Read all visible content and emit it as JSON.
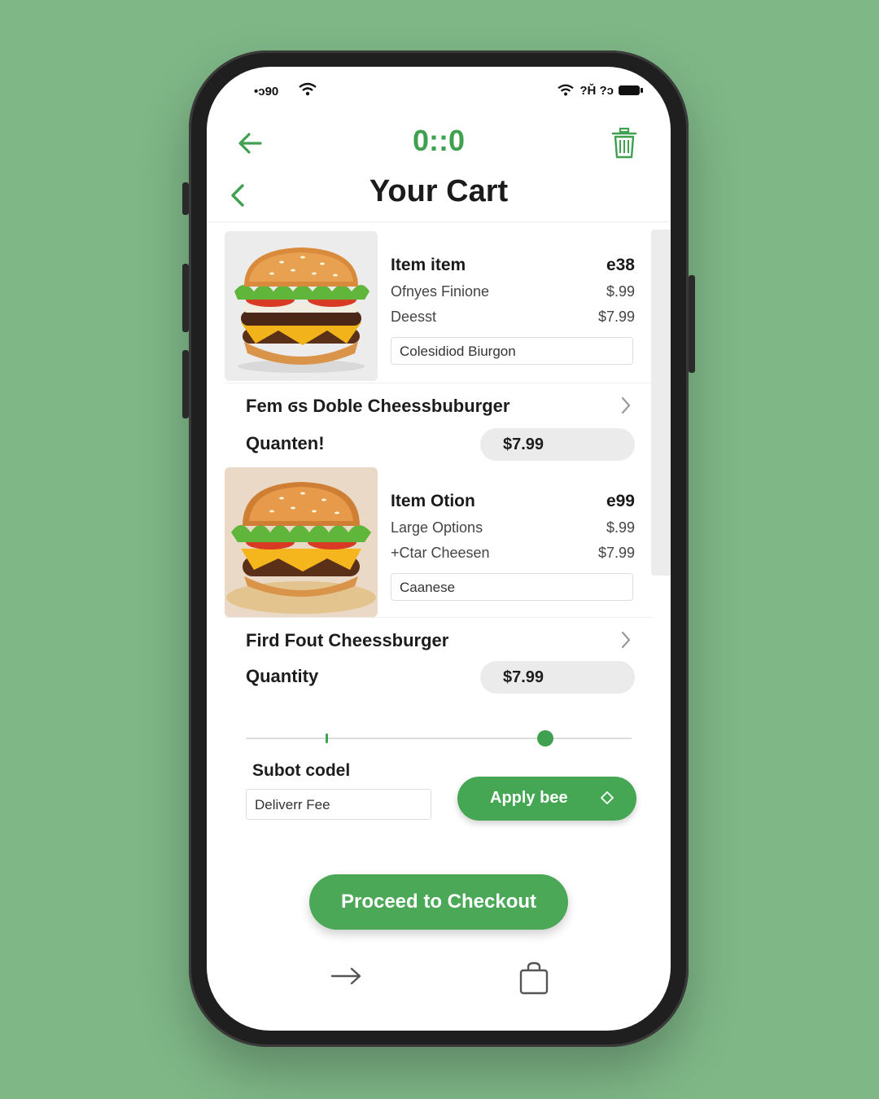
{
  "status_bar": {
    "carrier": "•ᴐ90",
    "right": "?Ȟ ?ᴐ"
  },
  "topbar": {
    "timer": "0::0"
  },
  "header": {
    "title": "Your Cart"
  },
  "items": [
    {
      "head_name": "Item item",
      "head_price": "e38",
      "opt1_name": "Ofnyes Finione",
      "opt1_price": "$.99",
      "opt2_name": "Deesst",
      "opt2_price": "$7.99",
      "note": "Colesidiod Biurgon",
      "title": "Fem ϭs Doble Cheessbuburger",
      "qty_label": "Quanten!",
      "price": "$7.99"
    },
    {
      "head_name": "Item Otion",
      "head_price": "e99",
      "opt1_name": "Large Options",
      "opt1_price": "$.99",
      "opt2_name": "+Ctar Cheesen",
      "opt2_price": "$7.99",
      "note": "Caanese",
      "title": "Fird Fout Cheessburger",
      "qty_label": "Quantity",
      "price": "$7.99"
    }
  ],
  "promo": {
    "label": "Subot codel",
    "input_value": "Deliverr Fee",
    "apply_label": "Apply bee"
  },
  "checkout": {
    "label": "Proceed to Checkout"
  },
  "icons": {
    "back": "arrow-left-icon",
    "trash": "trash-icon",
    "chevron": "chevron-left-icon",
    "nav_forward": "arrow-right-icon",
    "nav_cart": "shopping-bag-icon",
    "apply": "diamond-icon"
  },
  "colors": {
    "accent": "#45a653",
    "background": "#7fb787",
    "screen": "#ffffff"
  }
}
